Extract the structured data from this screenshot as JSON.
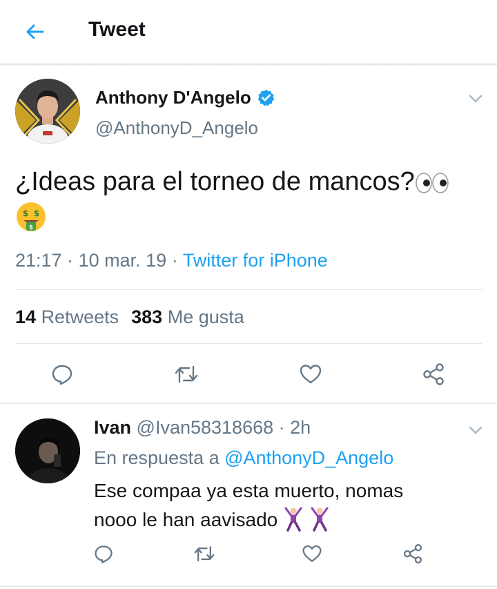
{
  "header": {
    "title": "Tweet"
  },
  "tweet": {
    "author_name": "Anthony D'Angelo",
    "author_handle": "@AnthonyD_Angelo",
    "text": "¿Ideas para el torneo de mancos?",
    "time": "21:17",
    "separator": "·",
    "date": "10 mar. 19",
    "source": "Twitter for iPhone",
    "retweets_count": "14",
    "retweets_label": "Retweets",
    "likes_count": "383",
    "likes_label": "Me gusta",
    "emojis": [
      "eyes-emoji",
      "money-mouth-emoji"
    ]
  },
  "reply": {
    "author_name": "Ivan",
    "author_handle": "@Ivan58318668",
    "separator": "·",
    "age": "2h",
    "in_reply_prefix": "En respuesta a",
    "in_reply_mention": "@AnthonyD_Angelo",
    "text_line1": "Ese compaa ya esta muerto, nomas",
    "text_line2": "nooo le han aavisado",
    "emojis": [
      "dancing-man-emoji",
      "dancing-man-emoji"
    ]
  },
  "colors": {
    "accent": "#1da1f2",
    "secondary_text": "#657786",
    "primary_text": "#14171a",
    "border": "#e1e8ed"
  }
}
